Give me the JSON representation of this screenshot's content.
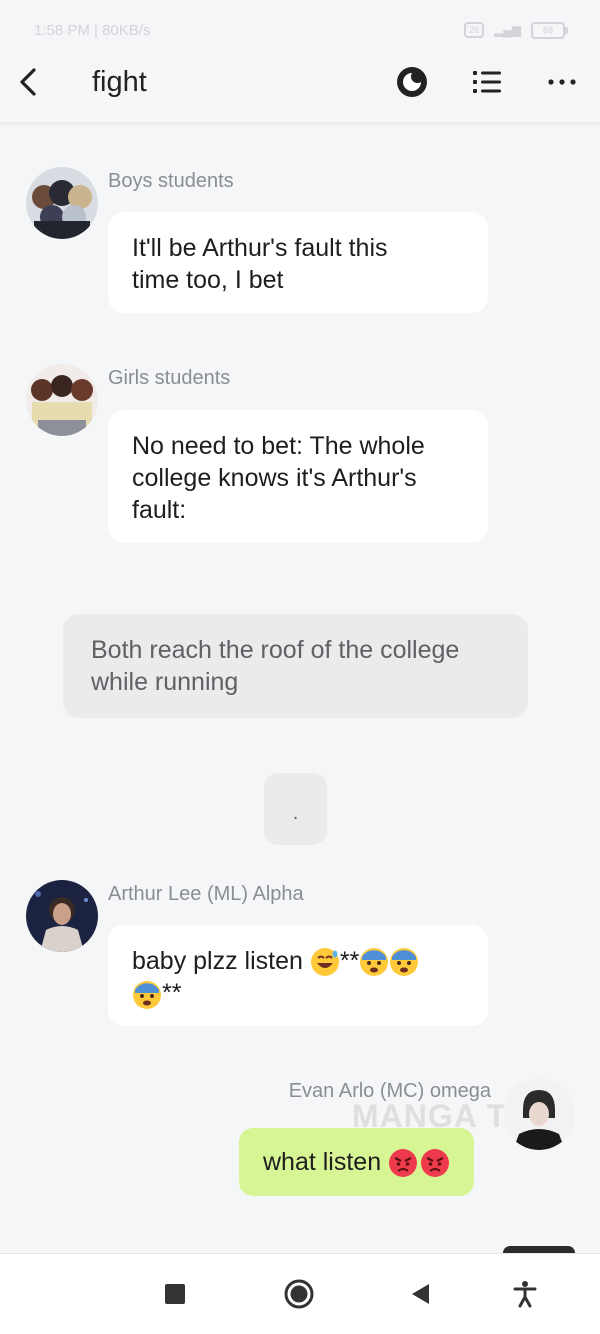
{
  "status": {
    "time_text": "1:58 PM | 80KB/s",
    "battery": "68"
  },
  "header": {
    "title": "fight"
  },
  "messages": [
    {
      "sender": "Boys students",
      "line1": "It'll be Arthur's fault this",
      "line2": "time too, I bet"
    },
    {
      "sender": "Girls students",
      "line1": "No need to bet: The whole",
      "line2": "college knows it's Arthur's",
      "line3": "fault:"
    },
    {
      "line1": "Both reach the roof of the college",
      "line2": "while running"
    },
    {
      "text": "."
    },
    {
      "sender": "Arthur Lee (ML) Alpha",
      "line1_text": "baby plzz listen ",
      "line1_sep": "**",
      "line2_tail": "**"
    },
    {
      "sender": "Evan Arlo (MC) omega",
      "text": "what listen "
    }
  ],
  "watermark": "MANGA TO",
  "colors": {
    "background": "#f5f6f8",
    "bubble": "#ffffff",
    "narration": "#ebebeb",
    "own_bubble": "#d8f595",
    "sender_text": "#8a8d92"
  },
  "icons": [
    "back-chevron-icon",
    "theme-toggle-icon",
    "list-icon",
    "more-icon",
    "stop-square-icon",
    "home-circle-icon",
    "back-triangle-icon",
    "accessibility-icon"
  ]
}
